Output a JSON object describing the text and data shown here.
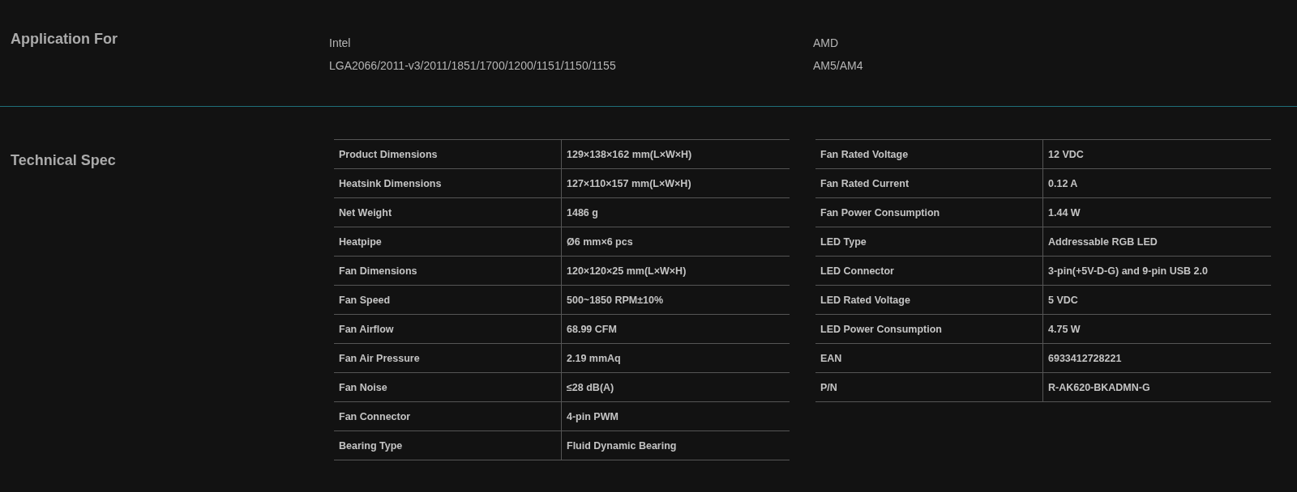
{
  "application": {
    "heading": "Application For",
    "platforms": [
      {
        "name": "Intel",
        "sockets": "LGA2066/2011-v3/2011/1851/1700/1200/1151/1150/1155"
      },
      {
        "name": "AMD",
        "sockets": "AM5/AM4"
      }
    ]
  },
  "technical_spec": {
    "heading": "Technical Spec",
    "tables": [
      {
        "rows": [
          {
            "label": "Product Dimensions",
            "value": "129×138×162 mm(L×W×H)"
          },
          {
            "label": "Heatsink Dimensions",
            "value": "127×110×157 mm(L×W×H)"
          },
          {
            "label": "Net Weight",
            "value": "1486 g"
          },
          {
            "label": "Heatpipe",
            "value": "Ø6 mm×6 pcs"
          },
          {
            "label": "Fan Dimensions",
            "value": "120×120×25 mm(L×W×H)"
          },
          {
            "label": "Fan Speed",
            "value": "500~1850 RPM±10%"
          },
          {
            "label": "Fan Airflow",
            "value": "68.99 CFM"
          },
          {
            "label": "Fan Air Pressure",
            "value": "2.19 mmAq"
          },
          {
            "label": "Fan Noise",
            "value": "≤28 dB(A)"
          },
          {
            "label": "Fan Connector",
            "value": "4-pin PWM"
          },
          {
            "label": "Bearing Type",
            "value": "Fluid Dynamic Bearing"
          }
        ]
      },
      {
        "rows": [
          {
            "label": "Fan Rated Voltage",
            "value": "12 VDC"
          },
          {
            "label": "Fan Rated Current",
            "value": "0.12 A"
          },
          {
            "label": "Fan Power Consumption",
            "value": "1.44 W"
          },
          {
            "label": "LED Type",
            "value": "Addressable RGB LED"
          },
          {
            "label": "LED Connector",
            "value": "3-pin(+5V-D-G) and 9-pin USB 2.0"
          },
          {
            "label": "LED Rated Voltage",
            "value": "5 VDC"
          },
          {
            "label": "LED Power Consumption",
            "value": "4.75 W"
          },
          {
            "label": "EAN",
            "value": "6933412728221"
          },
          {
            "label": "P/N",
            "value": "R-AK620-BKADMN-G"
          }
        ]
      }
    ]
  }
}
